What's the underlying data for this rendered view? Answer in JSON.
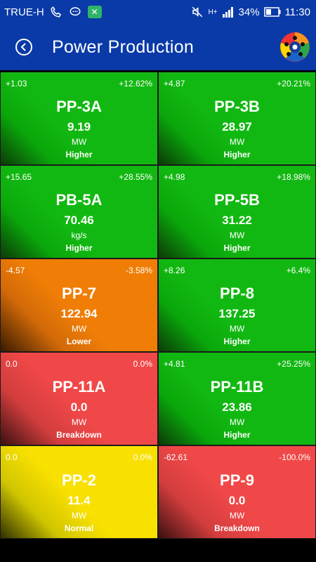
{
  "status_bar": {
    "carrier": "TRUE-H",
    "network": "H+",
    "battery": "34%",
    "time": "11:30"
  },
  "app_bar": {
    "title": "Power Production"
  },
  "tiles": [
    {
      "name": "PP-3A",
      "delta": "+1.03",
      "delta_pct": "+12.62%",
      "value": "9.19",
      "unit": "MW",
      "status": "Higher",
      "color": "green"
    },
    {
      "name": "PP-3B",
      "delta": "+4.87",
      "delta_pct": "+20.21%",
      "value": "28.97",
      "unit": "MW",
      "status": "Higher",
      "color": "green"
    },
    {
      "name": "PB-5A",
      "delta": "+15.65",
      "delta_pct": "+28.55%",
      "value": "70.46",
      "unit": "kg/s",
      "status": "Higher",
      "color": "green"
    },
    {
      "name": "PP-5B",
      "delta": "+4.98",
      "delta_pct": "+18.98%",
      "value": "31.22",
      "unit": "MW",
      "status": "Higher",
      "color": "green"
    },
    {
      "name": "PP-7",
      "delta": "-4.57",
      "delta_pct": "-3.58%",
      "value": "122.94",
      "unit": "MW",
      "status": "Lower",
      "color": "orange"
    },
    {
      "name": "PP-8",
      "delta": "+8.26",
      "delta_pct": "+6.4%",
      "value": "137.25",
      "unit": "MW",
      "status": "Higher",
      "color": "green"
    },
    {
      "name": "PP-11A",
      "delta": "0.0",
      "delta_pct": "0.0%",
      "value": "0.0",
      "unit": "MW",
      "status": "Breakdown",
      "color": "red"
    },
    {
      "name": "PP-11B",
      "delta": "+4.81",
      "delta_pct": "+25.25%",
      "value": "23.86",
      "unit": "MW",
      "status": "Higher",
      "color": "green"
    },
    {
      "name": "PP-2",
      "delta": "0.0",
      "delta_pct": "0.0%",
      "value": "11.4",
      "unit": "MW",
      "status": "Normal",
      "color": "yellow"
    },
    {
      "name": "PP-9",
      "delta": "-62.61",
      "delta_pct": "-100.0%",
      "value": "0.0",
      "unit": "MW",
      "status": "Breakdown",
      "color": "red"
    }
  ]
}
